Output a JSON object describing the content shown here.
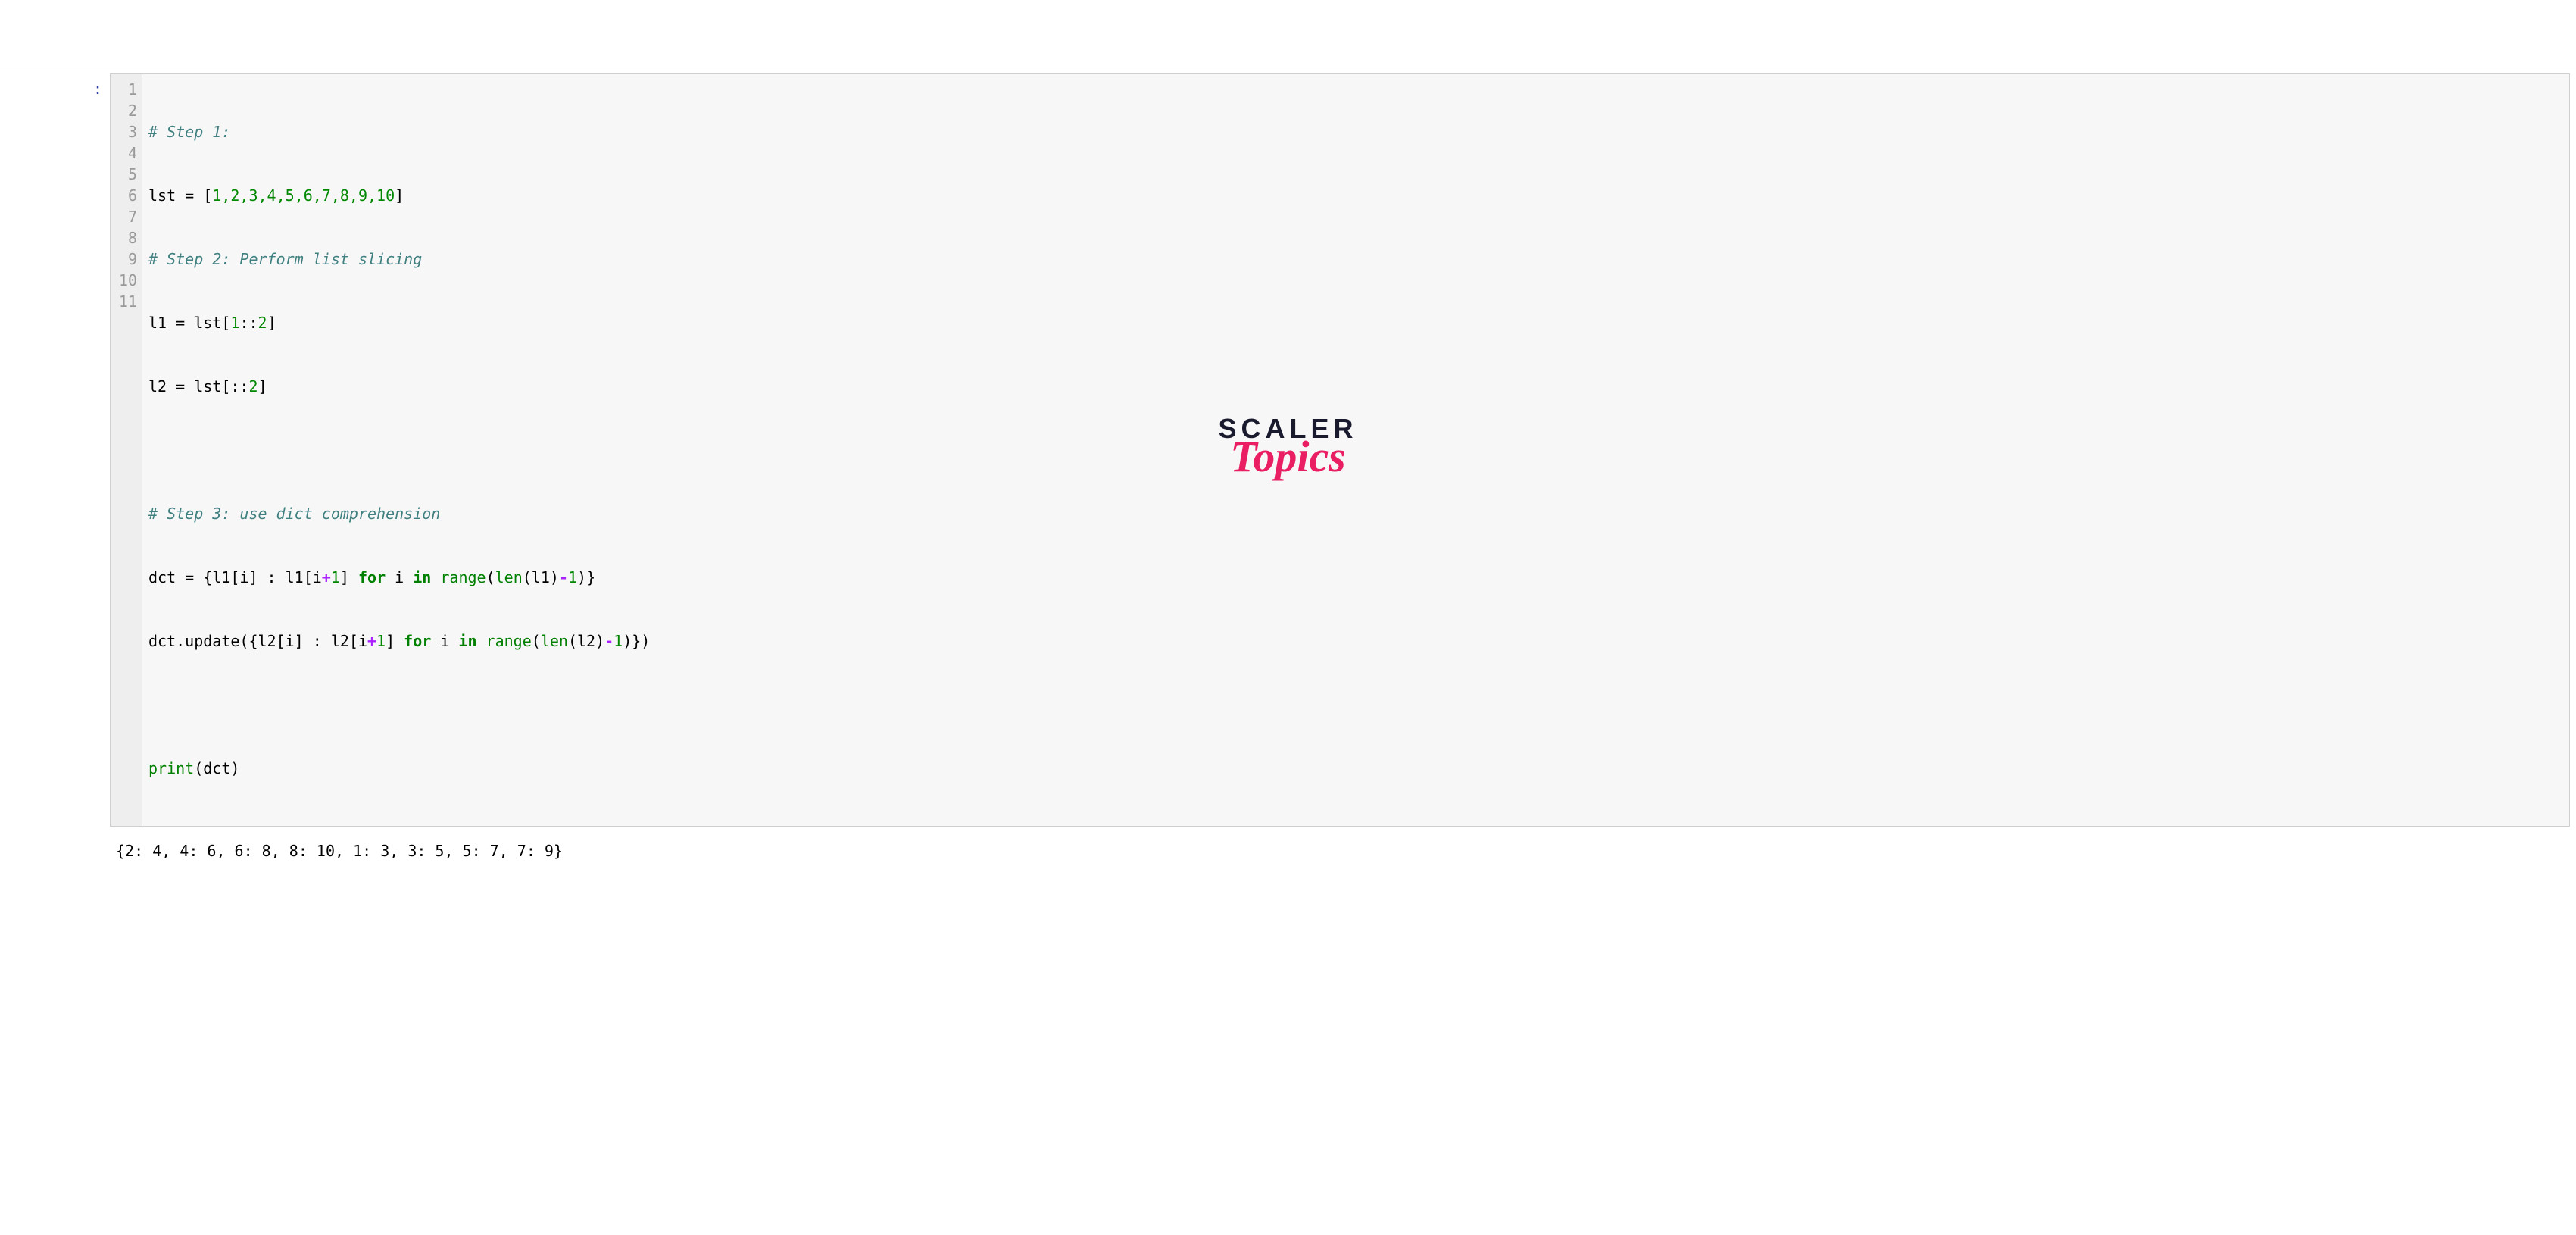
{
  "prompt": ":",
  "gutter": {
    "lines": [
      "1",
      "2",
      "3",
      "4",
      "5",
      "6",
      "7",
      "8",
      "9",
      "10",
      "11"
    ]
  },
  "code": {
    "l1_comment": "# Step 1:",
    "l2_var": "lst",
    "l2_eq": " = ",
    "l2_open": "[",
    "l2_nums": "1,2,3,4,5,6,7,8,9,10",
    "l2_close": "]",
    "l3_comment": "# Step 2: Perform list slicing",
    "l4_var": "l1",
    "l4_eq": " = ",
    "l4_expr_a": "lst[",
    "l4_num1": "1",
    "l4_expr_b": "::",
    "l4_num2": "2",
    "l4_expr_c": "]",
    "l5_var": "l2",
    "l5_eq": " = ",
    "l5_expr_a": "lst[::",
    "l5_num": "2",
    "l5_expr_b": "]",
    "l7_comment": "# Step 3: use dict comprehension",
    "l8_var": "dct",
    "l8_eq": " = ",
    "l8_a": "{l1[i] : l1[i",
    "l8_plus": "+",
    "l8_one": "1",
    "l8_b": "] ",
    "l8_for": "for",
    "l8_c": " i ",
    "l8_in": "in",
    "l8_d": " ",
    "l8_range": "range",
    "l8_e": "(",
    "l8_len": "len",
    "l8_f": "(l1)",
    "l8_minus": "-",
    "l8_one2": "1",
    "l8_g": ")}",
    "l9_a": "dct.update({l2[i] : l2[i",
    "l9_plus": "+",
    "l9_one": "1",
    "l9_b": "] ",
    "l9_for": "for",
    "l9_c": " i ",
    "l9_in": "in",
    "l9_d": " ",
    "l9_range": "range",
    "l9_e": "(",
    "l9_len": "len",
    "l9_f": "(l2)",
    "l9_minus": "-",
    "l9_one2": "1",
    "l9_g": ")})",
    "l11_print": "print",
    "l11_body": "(dct)"
  },
  "output": "{2: 4, 4: 6, 6: 8, 8: 10, 1: 3, 3: 5, 5: 7, 7: 9}",
  "logo": {
    "scaler": "SCALER",
    "topics": "Topics"
  }
}
